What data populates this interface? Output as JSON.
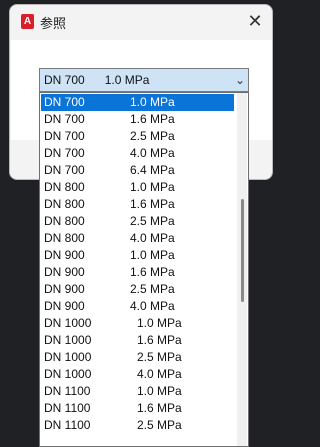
{
  "window": {
    "title": "参照",
    "app_icon_letter": "A",
    "close_symbol": "✕"
  },
  "combo": {
    "selected_dn": "DN 700",
    "selected_mpa": "1.0 MPa",
    "arrow": "⌄"
  },
  "list": {
    "items": [
      {
        "dn": "DN 700",
        "mpa": "1.0 MPa"
      },
      {
        "dn": "DN 700",
        "mpa": "1.6 MPa"
      },
      {
        "dn": "DN 700",
        "mpa": "2.5 MPa"
      },
      {
        "dn": "DN 700",
        "mpa": "4.0 MPa"
      },
      {
        "dn": "DN 700",
        "mpa": "6.4 MPa"
      },
      {
        "dn": "DN 800",
        "mpa": "1.0 MPa"
      },
      {
        "dn": "DN 800",
        "mpa": "1.6 MPa"
      },
      {
        "dn": "DN 800",
        "mpa": "2.5 MPa"
      },
      {
        "dn": "DN 800",
        "mpa": "4.0 MPa"
      },
      {
        "dn": "DN 900",
        "mpa": "1.0 MPa"
      },
      {
        "dn": "DN 900",
        "mpa": "1.6 MPa"
      },
      {
        "dn": "DN 900",
        "mpa": "2.5 MPa"
      },
      {
        "dn": "DN 900",
        "mpa": "4.0 MPa"
      },
      {
        "dn": "DN 1000",
        "mpa": "1.0 MPa"
      },
      {
        "dn": "DN 1000",
        "mpa": "1.6 MPa"
      },
      {
        "dn": "DN 1000",
        "mpa": "2.5 MPa"
      },
      {
        "dn": "DN 1000",
        "mpa": "4.0 MPa"
      },
      {
        "dn": "DN 1100",
        "mpa": "1.0 MPa"
      },
      {
        "dn": "DN 1100",
        "mpa": "1.6 MPa"
      },
      {
        "dn": "DN 1100",
        "mpa": "2.5 MPa"
      }
    ]
  },
  "colors": {
    "selection": "#0b74d8",
    "combo_bg": "#cfe3f7",
    "brand_icon": "#d7202a"
  }
}
